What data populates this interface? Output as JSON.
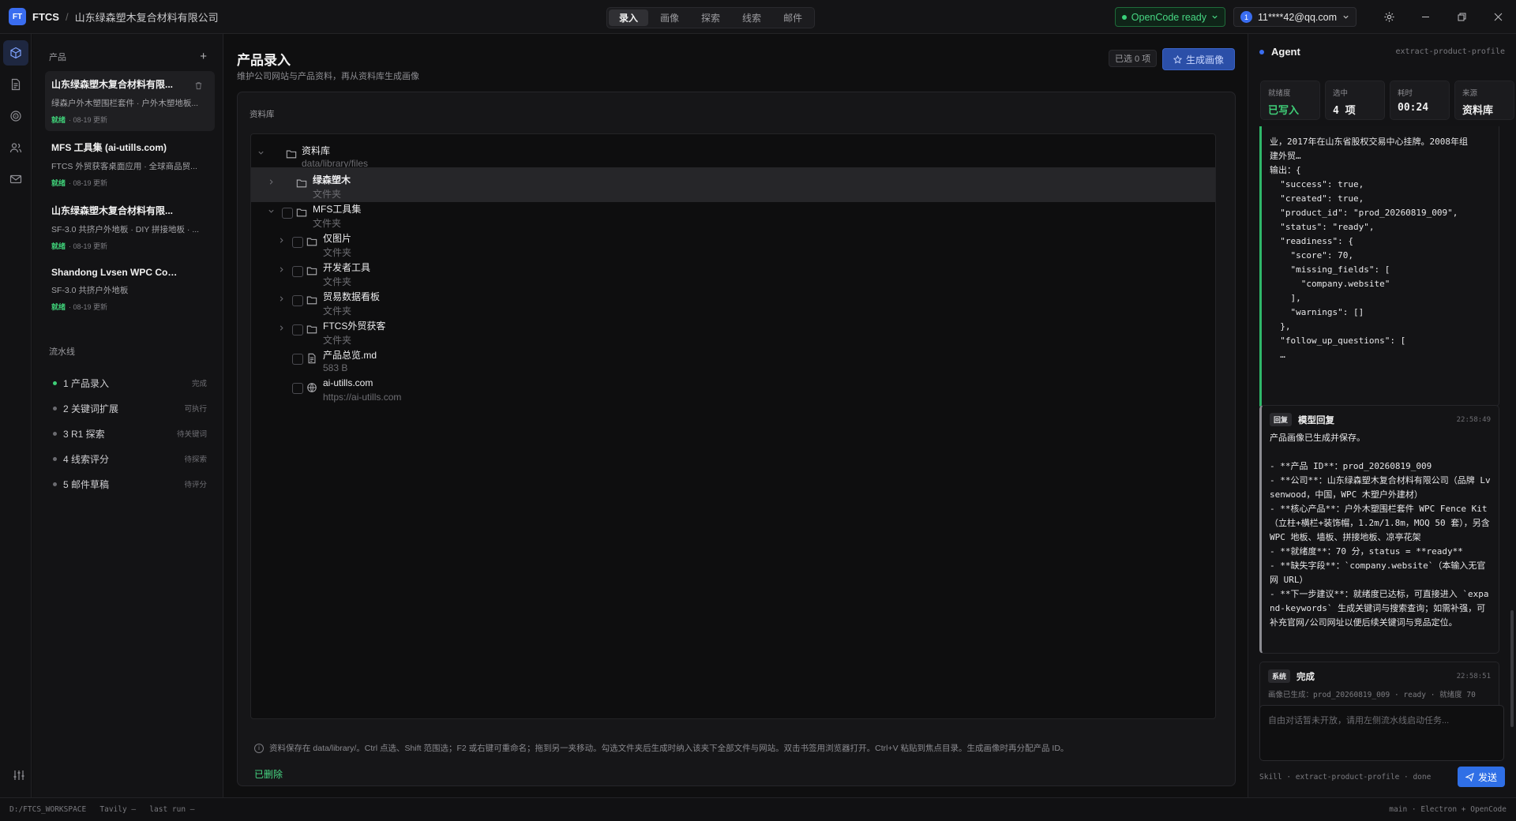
{
  "topbar": {
    "logo": "FT",
    "app_name": "FTCS",
    "separator": "/",
    "company": "山东绿森塑木复合材料有限公司",
    "tabs": [
      {
        "label": "录入",
        "active": true
      },
      {
        "label": "画像",
        "active": false
      },
      {
        "label": "探索",
        "active": false
      },
      {
        "label": "线索",
        "active": false
      },
      {
        "label": "邮件",
        "active": false
      }
    ],
    "opencode_status": "OpenCode ready",
    "account_avatar": "1",
    "account": "11****42@qq.com",
    "settings_icon": "gear-icon",
    "window_controls": [
      "minimize-icon",
      "restore-icon",
      "close-icon"
    ]
  },
  "rail": {
    "items": [
      "cube-icon",
      "document-icon",
      "radar-icon",
      "users-icon",
      "mail-icon"
    ],
    "bottom": "sliders-icon"
  },
  "sidebar": {
    "products_heading": "产品",
    "add_label": "+",
    "products": [
      {
        "title": "山东绿森塑木复合材料有限...",
        "desc": "绿森户外木塑围栏套件 · 户外木塑地板...",
        "status": "就绪",
        "updated": "· 08-19 更新",
        "active": true
      },
      {
        "title": "MFS 工具集 (ai-utills.com)",
        "desc": "FTCS 外贸获客桌面应用 · 全球商品贸...",
        "status": "就绪",
        "updated": "· 08-19 更新",
        "active": false
      },
      {
        "title": "山东绿森塑木复合材料有限...",
        "desc": "SF-3.0 共挤户外地板 · DIY 拼接地板 · ...",
        "status": "就绪",
        "updated": "· 08-19 更新",
        "active": false
      },
      {
        "title": "Shandong Lvsen WPC Com...",
        "desc": "SF-3.0 共挤户外地板",
        "status": "就绪",
        "updated": "· 08-19 更新",
        "active": false
      }
    ],
    "pipeline_heading": "流水线",
    "pipeline": [
      {
        "label": "1 产品录入",
        "status": "完成",
        "done": true
      },
      {
        "label": "2 关键词扩展",
        "status": "可执行",
        "done": false
      },
      {
        "label": "3 R1 探索",
        "status": "待关键词",
        "done": false
      },
      {
        "label": "4 线索评分",
        "status": "待探索",
        "done": false
      },
      {
        "label": "5 邮件草稿",
        "status": "待评分",
        "done": false
      }
    ]
  },
  "main": {
    "title": "产品录入",
    "subtitle": "维护公司网站与产品资料，再从资料库生成画像",
    "selected": "已选 0 项",
    "generate_label": "生成画像",
    "library_label": "资料库",
    "tree": [
      {
        "name": "资料库",
        "sub": "data/library/files",
        "type": "folder",
        "expanded": true,
        "level": 0,
        "checkbox": false
      },
      {
        "name": "绿森塑木",
        "sub": "文件夹",
        "type": "folder",
        "expanded": false,
        "level": 1,
        "checkbox": false,
        "highlight": true
      },
      {
        "name": "MFS工具集",
        "sub": "文件夹",
        "type": "folder",
        "expanded": true,
        "level": 1,
        "checkbox": true
      },
      {
        "name": "仅图片",
        "sub": "文件夹",
        "type": "folder",
        "expanded": false,
        "level": 2,
        "checkbox": true
      },
      {
        "name": "开发者工具",
        "sub": "文件夹",
        "type": "folder",
        "expanded": false,
        "level": 2,
        "checkbox": true
      },
      {
        "name": "贸易数据看板",
        "sub": "文件夹",
        "type": "folder",
        "expanded": false,
        "level": 2,
        "checkbox": true
      },
      {
        "name": "FTCS外贸获客",
        "sub": "文件夹",
        "type": "folder",
        "expanded": false,
        "level": 2,
        "checkbox": true
      },
      {
        "name": "产品总览.md",
        "sub": "583 B",
        "type": "file",
        "level": 2,
        "checkbox": true
      },
      {
        "name": "ai-utills.com",
        "sub": "https://ai-utills.com",
        "type": "link",
        "level": 2,
        "checkbox": true
      }
    ],
    "hint": "资料保存在 data/library/。Ctrl 点选、Shift 范围选；F2 或右键可重命名；拖到另一夹移动。勾选文件夹后生成时纳入该夹下全部文件与网站。双击书签用浏览器打开。Ctrl+V 粘贴到焦点目录。生成画像时再分配产品 ID。",
    "deleted": "已删除"
  },
  "agent": {
    "title": "Agent",
    "skill": "extract-product-profile",
    "stats": [
      {
        "label": "就绪度",
        "value": "已写入",
        "green": true
      },
      {
        "label": "选中",
        "value": "4 项",
        "green": false
      },
      {
        "label": "耗时",
        "value": "00:24",
        "green": false
      },
      {
        "label": "来源",
        "value": "资料库",
        "green": false
      }
    ],
    "code_output": "业，2017年在山东省股权交易中心挂牌。2008年组\n建外贸…\n输出：{\n  \"success\": true,\n  \"created\": true,\n  \"product_id\": \"prod_20260819_009\",\n  \"status\": \"ready\",\n  \"readiness\": {\n    \"score\": 70,\n    \"missing_fields\": [\n      \"company.website\"\n    ],\n    \"warnings\": []\n  },\n  \"follow_up_questions\": [\n  …",
    "reply": {
      "tag": "回复",
      "title": "模型回复",
      "time": "22:58:49",
      "body": "产品画像已生成并保存。\n\n- **产品 ID**：prod_20260819_009\n- **公司**：山东绿森塑木复合材料有限公司（品牌 Lvsenwood，中国，WPC 木塑户外建材）\n- **核心产品**：户外木塑围栏套件 WPC Fence Kit（立柱+横栏+装饰帽，1.2m/1.8m，MOQ 50 套），另含 WPC 地板、墙板、拼接地板、凉亭花架\n- **就绪度**：70 分，status = **ready**\n- **缺失字段**：`company.website`（本输入无官网 URL）\n- **下一步建议**：就绪度已达标，可直接进入 `expand-keywords` 生成关键词与搜索查询；如需补强，可补充官网/公司网址以便后续关键词与竞品定位。"
    },
    "system": {
      "tag": "系统",
      "title": "完成",
      "time": "22:58:51",
      "body": "画像已生成：prod_20260819_009 · ready · 就绪度 70"
    },
    "input_placeholder": "自由对话暂未开放，请用左侧流水线启动任务...",
    "footer": "Skill · extract-product-profile · done",
    "send_label": "发送"
  },
  "statusbar": {
    "left": "D:/FTCS_WORKSPACE   Tavily —   last run —",
    "right": "main · Electron + OpenCode"
  }
}
